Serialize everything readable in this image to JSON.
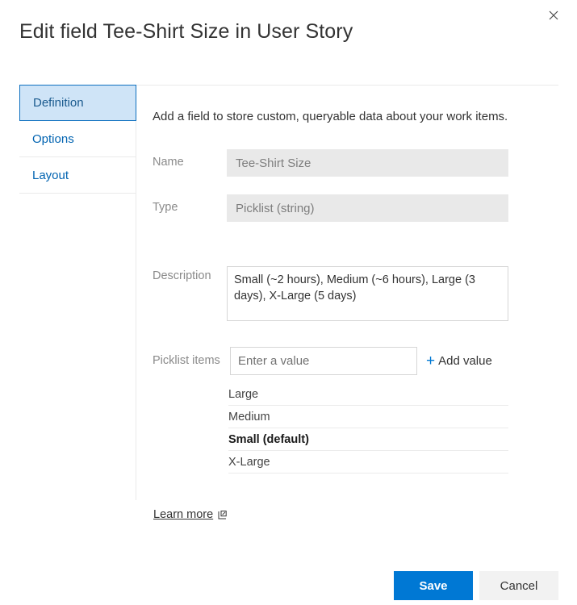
{
  "dialog": {
    "title": "Edit field Tee-Shirt Size in User Story",
    "close_icon": "close-icon"
  },
  "sidebar": {
    "items": [
      {
        "label": "Definition",
        "selected": true
      },
      {
        "label": "Options",
        "selected": false
      },
      {
        "label": "Layout",
        "selected": false
      }
    ]
  },
  "main": {
    "intro": "Add a field to store custom, queryable data about your work items.",
    "fields": {
      "name": {
        "label": "Name",
        "value": "Tee-Shirt Size",
        "disabled": true
      },
      "type": {
        "label": "Type",
        "value": "Picklist (string)",
        "disabled": true
      },
      "description": {
        "label": "Description",
        "value": "Small (~2 hours), Medium (~6 hours), Large (3 days), X-Large (5 days)"
      },
      "picklist": {
        "label": "Picklist items",
        "input_placeholder": "Enter a value",
        "input_value": "",
        "add_label": "Add value",
        "add_icon": "plus-icon",
        "items": [
          {
            "label": "Large"
          },
          {
            "label": "Medium"
          },
          {
            "label": "Small (default)"
          },
          {
            "label": "X-Large"
          }
        ]
      }
    },
    "learn_more": {
      "label": "Learn more",
      "icon": "external-link-icon"
    }
  },
  "footer": {
    "save_label": "Save",
    "cancel_label": "Cancel"
  },
  "colors": {
    "accent": "#0078d4",
    "selected_tab_bg": "#cfe4f7",
    "selected_tab_border": "#0e70bf",
    "link": "#0063b1",
    "disabled_field_bg": "#e9e9e9"
  }
}
